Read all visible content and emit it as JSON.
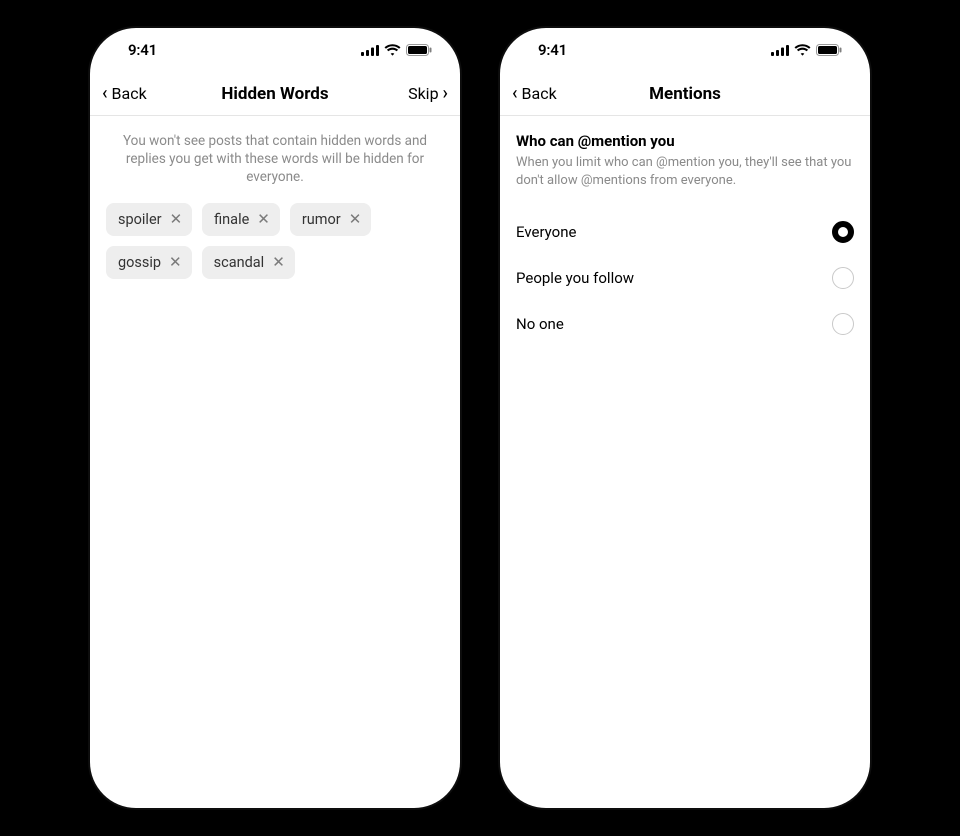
{
  "status": {
    "time": "9:41"
  },
  "left_phone": {
    "nav": {
      "back_label": "Back",
      "title": "Hidden Words",
      "skip_label": "Skip"
    },
    "description": "You won't see posts that contain hidden words and replies you get with these words will be hidden for everyone.",
    "chips": {
      "0": "spoiler",
      "1": "finale",
      "2": "rumor",
      "3": "gossip",
      "4": "scandal"
    }
  },
  "right_phone": {
    "nav": {
      "back_label": "Back",
      "title": "Mentions"
    },
    "section": {
      "title": "Who can @mention you",
      "description": "When you limit who can @mention you, they'll see that you don't allow @mentions from everyone."
    },
    "options": {
      "0": {
        "label": "Everyone",
        "selected": true
      },
      "1": {
        "label": "People you follow",
        "selected": false
      },
      "2": {
        "label": "No one",
        "selected": false
      }
    }
  }
}
